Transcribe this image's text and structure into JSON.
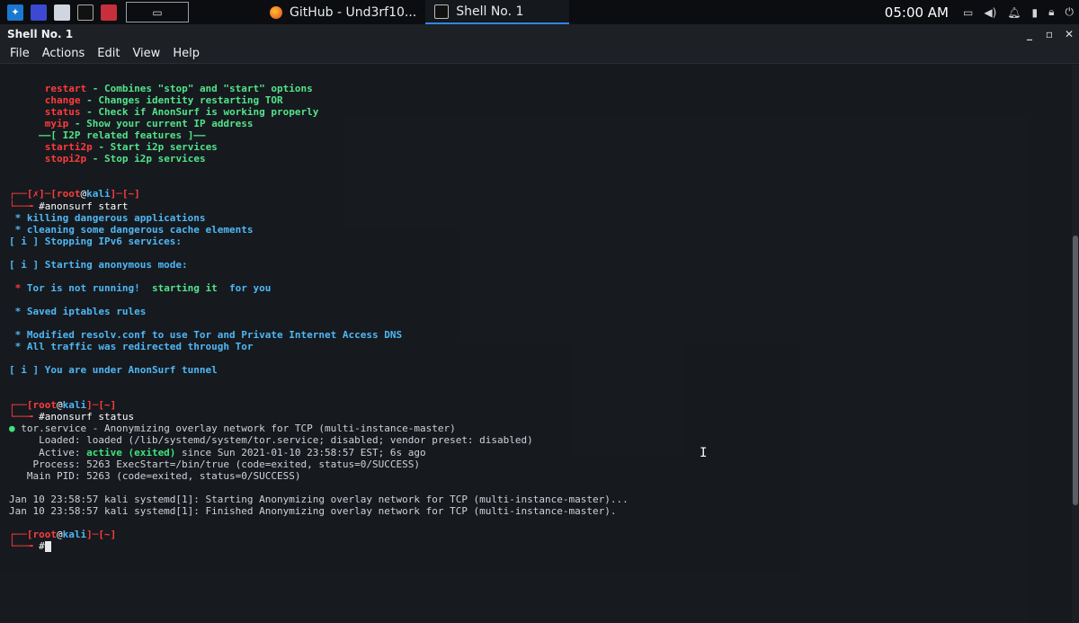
{
  "panel": {
    "tasks": [
      {
        "label": "GitHub - Und3rf10...",
        "icon": "firefox-icon"
      },
      {
        "label": "Shell No. 1",
        "icon": "terminal-icon"
      }
    ],
    "clock": "05:00 AM"
  },
  "window": {
    "title": "Shell No. 1",
    "controls": [
      "_",
      "▫",
      "✕"
    ]
  },
  "menu": [
    "File",
    "Actions",
    "Edit",
    "View",
    "Help"
  ],
  "terminal": {
    "help": [
      {
        "cmd": "restart",
        "desc": " - Combines \"stop\" and \"start\" options"
      },
      {
        "cmd": "change",
        "desc": " - Changes identity restarting TOR"
      },
      {
        "cmd": "status",
        "desc": " - Check if AnonSurf is working properly"
      },
      {
        "cmd": "myip",
        "desc": " - Show your current IP address"
      },
      {
        "cmd": "",
        "desc": "——[ I2P related features ]——"
      },
      {
        "cmd": "starti2p",
        "desc": " - Start i2p services"
      },
      {
        "cmd": "stopi2p",
        "desc": " - Stop i2p services"
      }
    ],
    "prompt1": {
      "head": "┌──[",
      "x": "✗",
      "mid": "]─[",
      "user": "root",
      "at": "@",
      "host": "kali",
      "tail": "]─[~]",
      "cmd_prefix": "└──╼ ",
      "cmd": "#anonsurf start"
    },
    "start_output": [
      {
        "text": " * killing dangerous applications",
        "style": "blu"
      },
      {
        "text": " * cleaning some dangerous cache elements",
        "style": "blu"
      },
      {
        "text": "[ i ] Stopping IPv6 services:",
        "style": "blu"
      },
      {
        "text": "",
        "style": "blu"
      },
      {
        "text": "[ i ] Starting anonymous mode:",
        "style": "blu"
      },
      {
        "text": "",
        "style": "blu"
      },
      {
        "text": "tor_line",
        "style": "special"
      },
      {
        "text": "",
        "style": "blu"
      },
      {
        "text": " * Saved iptables rules",
        "style": "blu"
      },
      {
        "text": "",
        "style": "blu"
      },
      {
        "text": " * Modified resolv.conf to use Tor and Private Internet Access DNS",
        "style": "blu"
      },
      {
        "text": " * All traffic was redirected through Tor",
        "style": "blu"
      },
      {
        "text": "",
        "style": "blu"
      },
      {
        "text": "[ i ] You are under AnonSurf tunnel",
        "style": "blu"
      }
    ],
    "tor_line": {
      "star": " * ",
      "a": "Tor is not running! ",
      "b": " starting it ",
      "c": " for you"
    },
    "prompt2": {
      "head": "┌──[",
      "user": "root",
      "at": "@",
      "host": "kali",
      "tail": "]─[~]",
      "cmd_prefix": "└──╼ ",
      "cmd": "#anonsurf status"
    },
    "status": {
      "dot": "●",
      "unit": " tor.service - Anonymizing overlay network for TCP (multi-instance-master)",
      "loaded": "     Loaded: loaded (/lib/systemd/system/tor.service; disabled; vendor preset: disabled)",
      "active_label": "     Active: ",
      "active_value": "active (exited)",
      "active_rest": " since Sun 2021-01-10 23:58:57 EST; 6s ago",
      "process": "    Process: 5263 ExecStart=/bin/true (code=exited, status=0/SUCCESS)",
      "mainpid": "   Main PID: 5263 (code=exited, status=0/SUCCESS)",
      "log1": "Jan 10 23:58:57 kali systemd[1]: Starting Anonymizing overlay network for TCP (multi-instance-master)...",
      "log2": "Jan 10 23:58:57 kali systemd[1]: Finished Anonymizing overlay network for TCP (multi-instance-master)."
    },
    "prompt3": {
      "head": "┌──[",
      "user": "root",
      "at": "@",
      "host": "kali",
      "tail": "]─[~]",
      "cmd_prefix": "└──╼ ",
      "cmd": "#"
    }
  }
}
